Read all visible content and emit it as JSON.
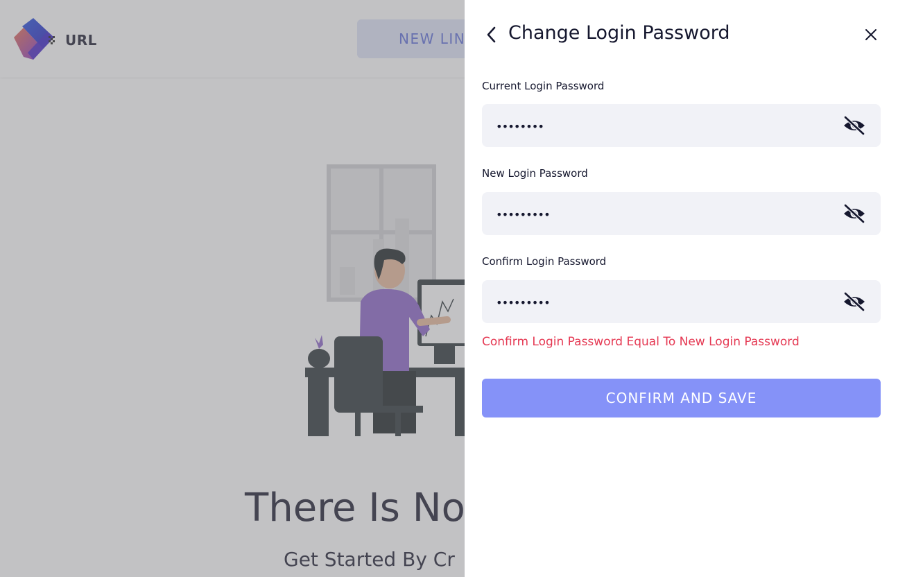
{
  "app": {
    "logo_text": "URL",
    "new_link_label": "NEW LINK",
    "empty_title": "There Is No",
    "empty_subtitle": "Get Started By Cr"
  },
  "drawer": {
    "title": "Change Login Password",
    "back_icon": "chevron-left-icon",
    "close_icon": "close-icon",
    "fields": [
      {
        "label": "Current Login Password",
        "value": "••••••••",
        "icon": "eye-off-icon"
      },
      {
        "label": "New Login Password",
        "value": "•••••••••",
        "icon": "eye-off-icon"
      },
      {
        "label": "Confirm Login Password",
        "value": "•••••••••",
        "icon": "eye-off-icon"
      }
    ],
    "error_message": "Confirm Login Password Equal To New Login Password",
    "confirm_label": "CONFIRM AND SAVE"
  },
  "colors": {
    "primary": "#8592f8",
    "error": "#e53953",
    "field_bg": "#f1f2f7",
    "text_dark": "#15172e",
    "accent_purple": "#8a63c9"
  }
}
